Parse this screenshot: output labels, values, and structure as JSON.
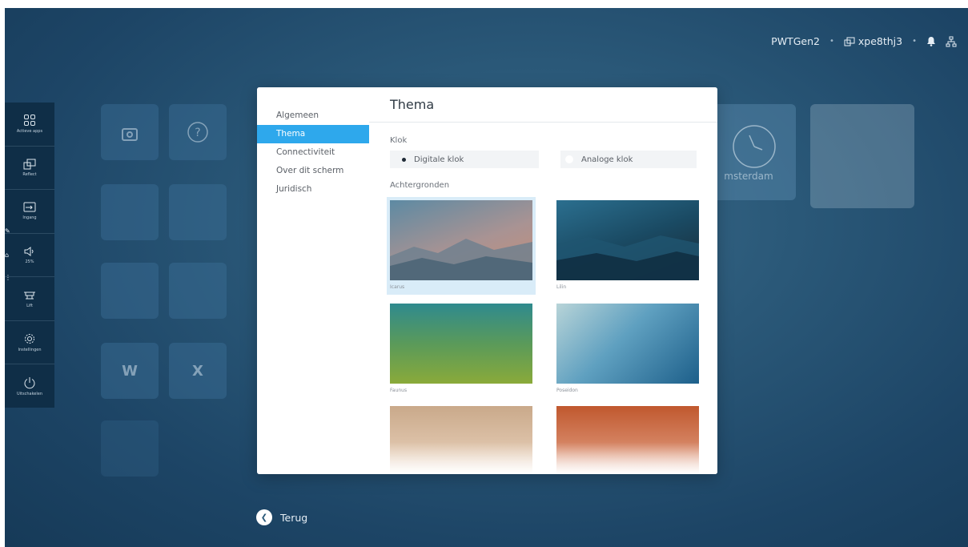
{
  "statusbar": {
    "device_name": "PWTGen2",
    "share_code": "xpe8thj3",
    "share_icon": "cast-icon",
    "bell_icon": "bell-icon",
    "network_icon": "network-icon"
  },
  "dock": {
    "items": [
      {
        "icon": "apps-grid-icon",
        "label": "Actieve apps"
      },
      {
        "icon": "reflect-icon",
        "label": "Reflect"
      },
      {
        "icon": "input-icon",
        "label": "Ingang"
      },
      {
        "icon": "volume-icon",
        "label": "25%"
      },
      {
        "icon": "lift-icon",
        "label": "Lift"
      },
      {
        "icon": "gear-icon",
        "label": "Instellingen"
      },
      {
        "icon": "power-icon",
        "label": "Uitschakelen"
      }
    ]
  },
  "background": {
    "clock_city": "msterdam"
  },
  "settings": {
    "menu": [
      {
        "label": "Algemeen",
        "active": false
      },
      {
        "label": "Thema",
        "active": true
      },
      {
        "label": "Connectiviteit",
        "active": false
      },
      {
        "label": "Over dit scherm",
        "active": false
      },
      {
        "label": "Juridisch",
        "active": false
      }
    ],
    "title": "Thema",
    "clock_label": "Klok",
    "clock_options": [
      {
        "label": "Digitale klok",
        "selected": true
      },
      {
        "label": "Analoge klok",
        "selected": false
      }
    ],
    "backgrounds_label": "Achtergronden",
    "backgrounds": [
      {
        "name": "Icarus",
        "selected": true
      },
      {
        "name": "Lilin",
        "selected": false
      },
      {
        "name": "Faunus",
        "selected": false
      },
      {
        "name": "Poseidon",
        "selected": false
      },
      {
        "name": "",
        "selected": false
      },
      {
        "name": "",
        "selected": false
      }
    ]
  },
  "back_label": "Terug"
}
